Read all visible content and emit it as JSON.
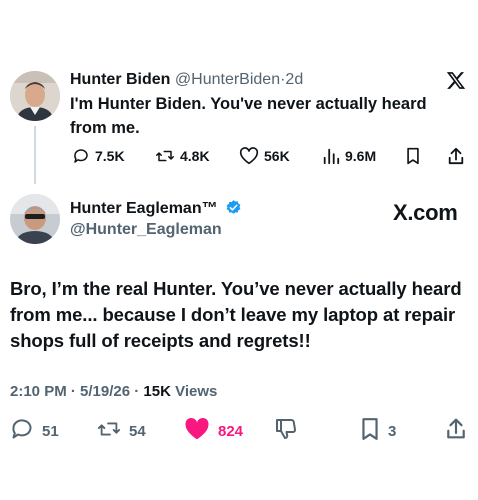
{
  "quoted": {
    "name": "Hunter Biden",
    "handle": "@HunterBiden",
    "age": "2d",
    "text": "I'm Hunter Biden. You've never actually heard from me.",
    "stats": {
      "replies": "7.5K",
      "reposts": "4.8K",
      "likes": "56K",
      "views": "9.6M"
    }
  },
  "main": {
    "name": "Hunter Eagleman™",
    "handle": "@Hunter_Eagleman",
    "site": "X.com",
    "text": "Bro, I’m the real Hunter. You’ve never actually heard from me... because I don’t leave my laptop at repair shops full of receipts and regrets!!",
    "timestamp": "2:10 PM · 5/19/26 · ",
    "views_count": "15K",
    "views_label": " Views",
    "actions": {
      "replies": "51",
      "reposts": "54",
      "likes": "824",
      "bookmarks": "3"
    }
  },
  "colors": {
    "like_pink": "#f91880",
    "verified_blue": "#1d9bf0",
    "muted": "#536471"
  },
  "icons": [
    "x-logo-icon",
    "reply-icon",
    "repost-icon",
    "heart-icon",
    "views-icon",
    "bookmark-icon",
    "share-icon",
    "dislike-icon",
    "verified-icon"
  ]
}
